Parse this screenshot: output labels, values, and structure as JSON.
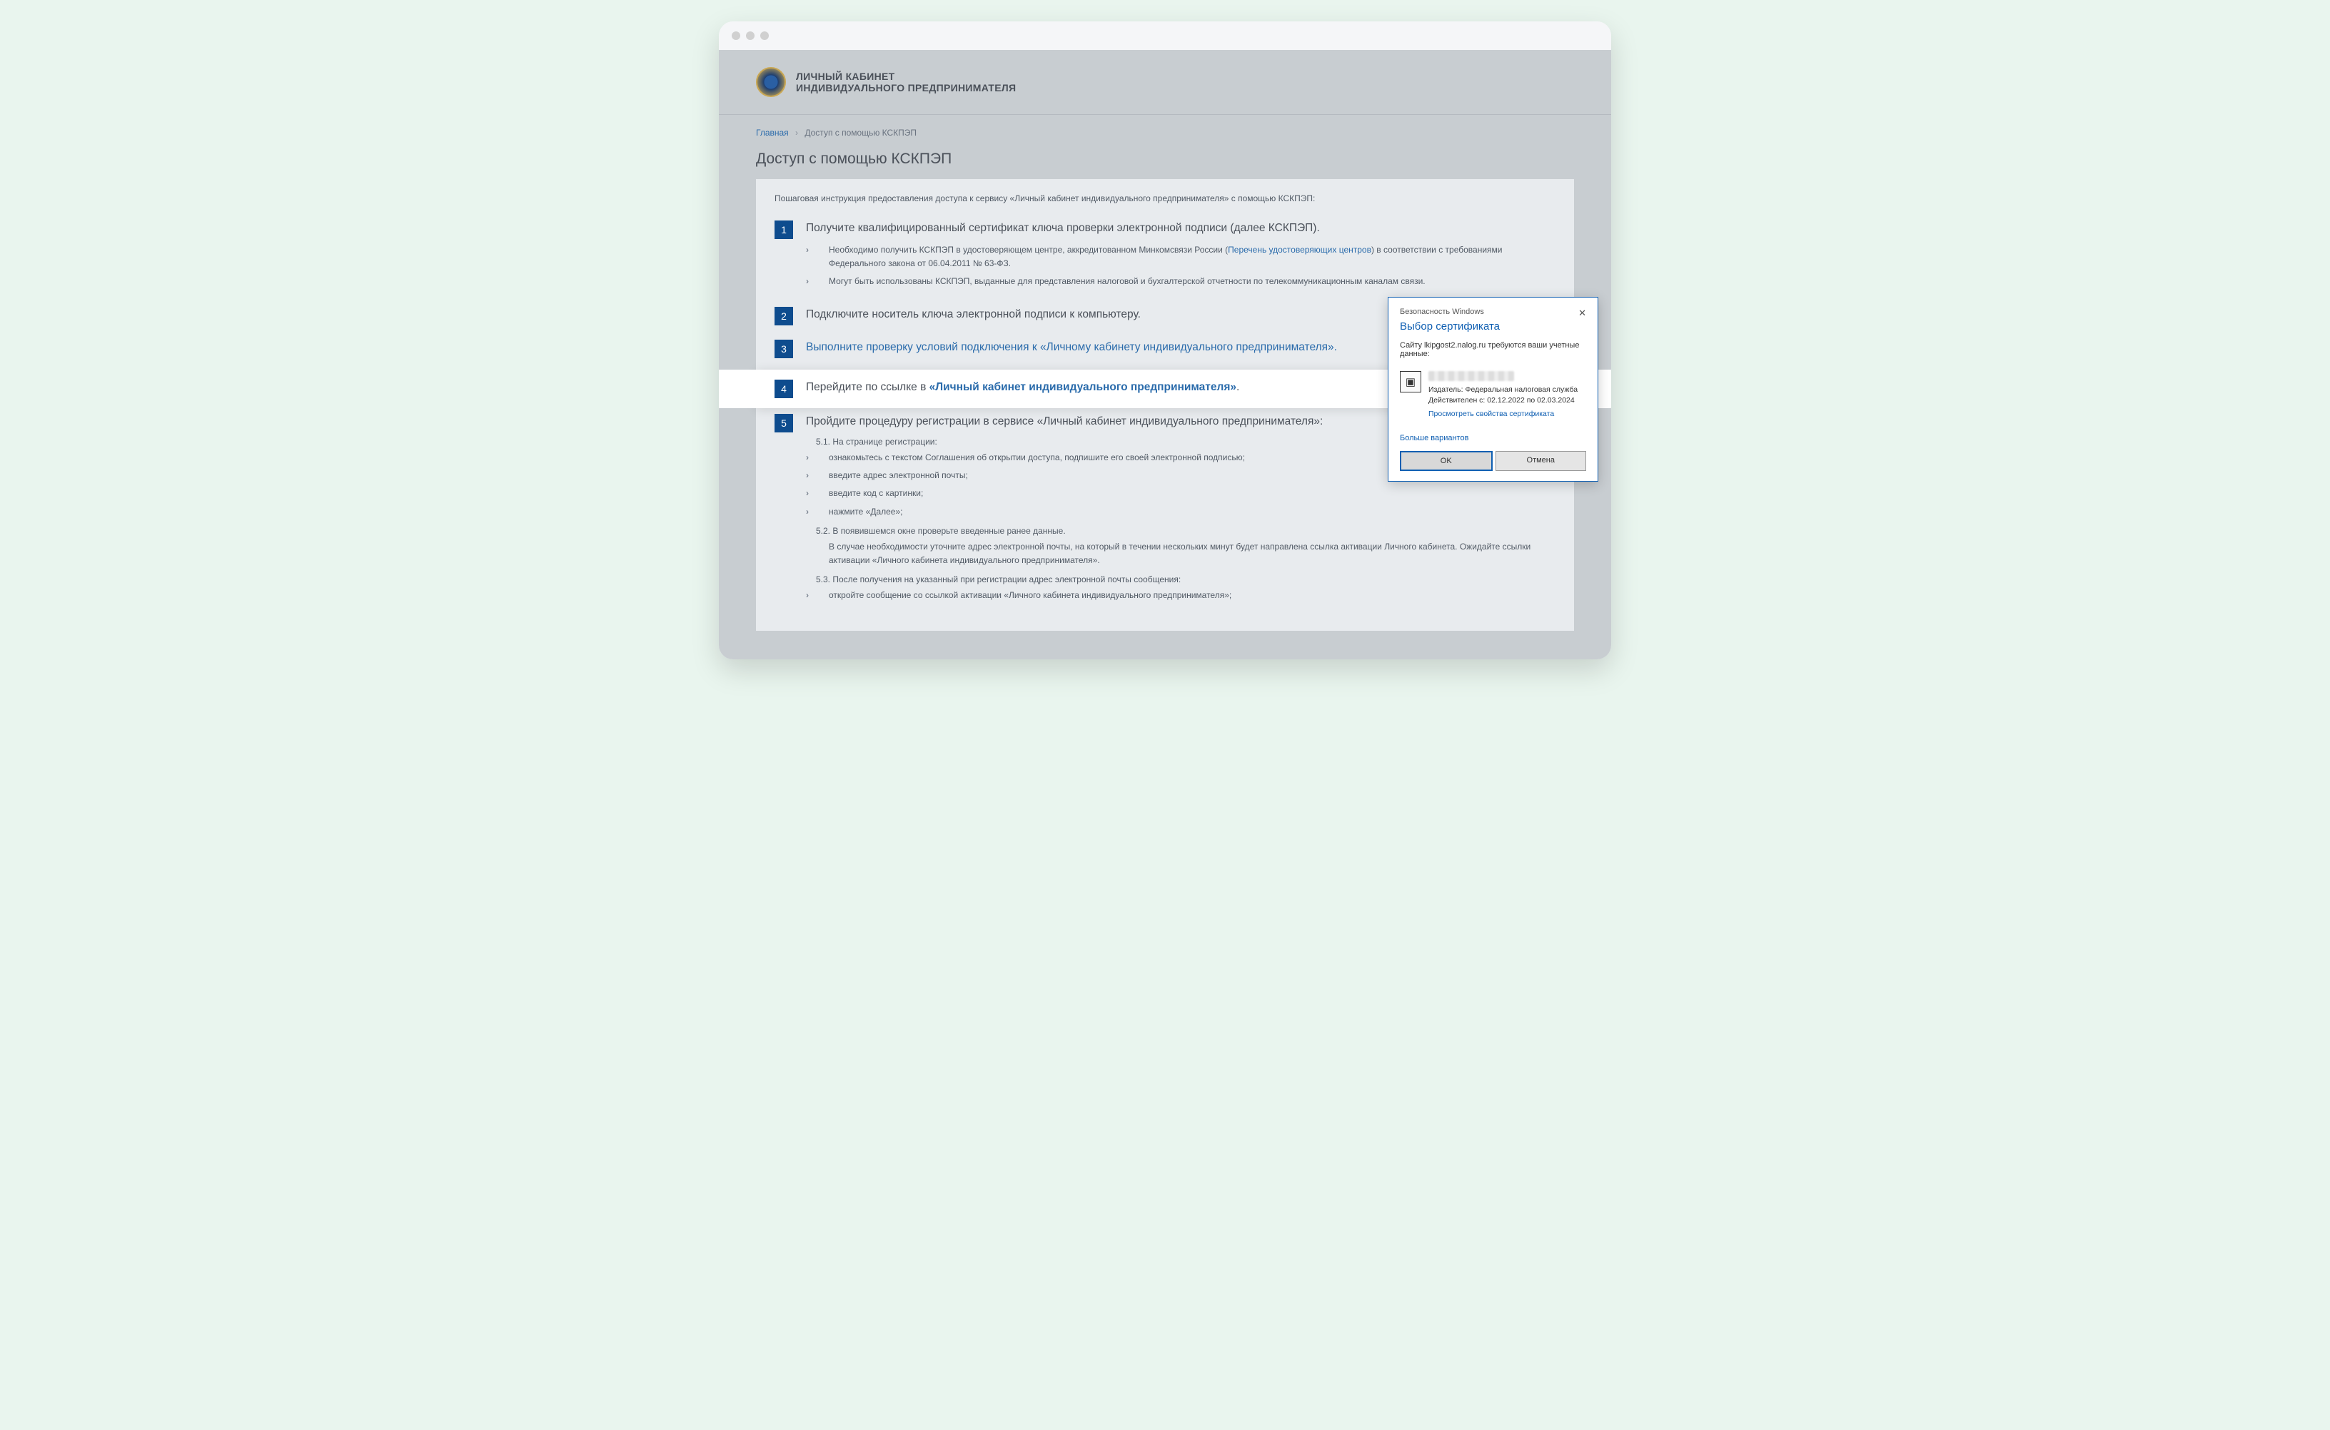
{
  "header": {
    "title1": "ЛИЧНЫЙ КАБИНЕТ",
    "title2": "ИНДИВИДУАЛЬНОГО ПРЕДПРИНИМАТЕЛЯ"
  },
  "breadcrumb": {
    "home": "Главная",
    "current": "Доступ с помощью КСКПЭП"
  },
  "page": {
    "title": "Доступ с помощью КСКПЭП",
    "intro": "Пошаговая инструкция предоставления доступа к сервису «Личный кабинет индивидуального предпринимателя» с помощью КСКПЭП:"
  },
  "steps": {
    "s1": {
      "num": "1",
      "title": "Получите квалифицированный сертификат ключа проверки электронной подписи (далее КСКПЭП).",
      "sub1_pre": "Необходимо получить КСКПЭП в удостоверяющем центре, аккредитованном Минкомсвязи России (",
      "sub1_link": "Перечень удостоверяющих центров",
      "sub1_post": ") в соответствии с требованиями Федерального закона от 06.04.2011 № 63-ФЗ.",
      "sub2": "Могут быть использованы КСКПЭП, выданные для представления налоговой и бухгалтерской отчетности по телекоммуникационным каналам связи."
    },
    "s2": {
      "num": "2",
      "title": "Подключите носитель ключа электронной подписи к компьютеру."
    },
    "s3": {
      "num": "3",
      "pre": "Выполните проверку условий подключения к ",
      "link": "«Личному кабинету индивидуального предпринимателя»",
      "post": "."
    },
    "s4": {
      "num": "4",
      "pre": "Перейдите по ссылке в ",
      "link": "«Личный кабинет индивидуального предпринимателя»",
      "post": "."
    },
    "s5": {
      "num": "5",
      "title": "Пройдите процедуру регистрации в сервисе «Личный кабинет индивидуального предпринимателя»:",
      "n51": "5.1. На странице регистрации:",
      "i1": "ознакомьтесь с текстом Соглашения об открытии доступа, подпишите его своей электронной подписью;",
      "i2": "введите адрес электронной почты;",
      "i3": "введите код с картинки;",
      "i4": "нажмите «Далее»;",
      "n52": "5.2. В появившемся окне проверьте введенные ранее данные.",
      "p52": "В случае необходимости уточните адрес электронной почты, на который в течении нескольких минут будет направлена ссылка активации Личного кабинета. Ожидайте ссылки активации «Личного кабинета индивидуального предпринимателя».",
      "n53": "5.3. После получения на указанный при регистрации адрес электронной почты сообщения:",
      "i53": "откройте сообщение со ссылкой активации «Личного кабинета индивидуального предпринимателя»;"
    }
  },
  "dialog": {
    "security": "Безопасность Windows",
    "title": "Выбор сертификата",
    "msg": "Сайту lkipgost2.nalog.ru требуются ваши учетные данные:",
    "issuer": "Издатель: Федеральная налоговая служба",
    "validity": "Действителен с: 02.12.2022 по 02.03.2024",
    "view_props": "Просмотреть свойства сертификата",
    "more": "Больше вариантов",
    "ok": "OK",
    "cancel": "Отмена"
  }
}
